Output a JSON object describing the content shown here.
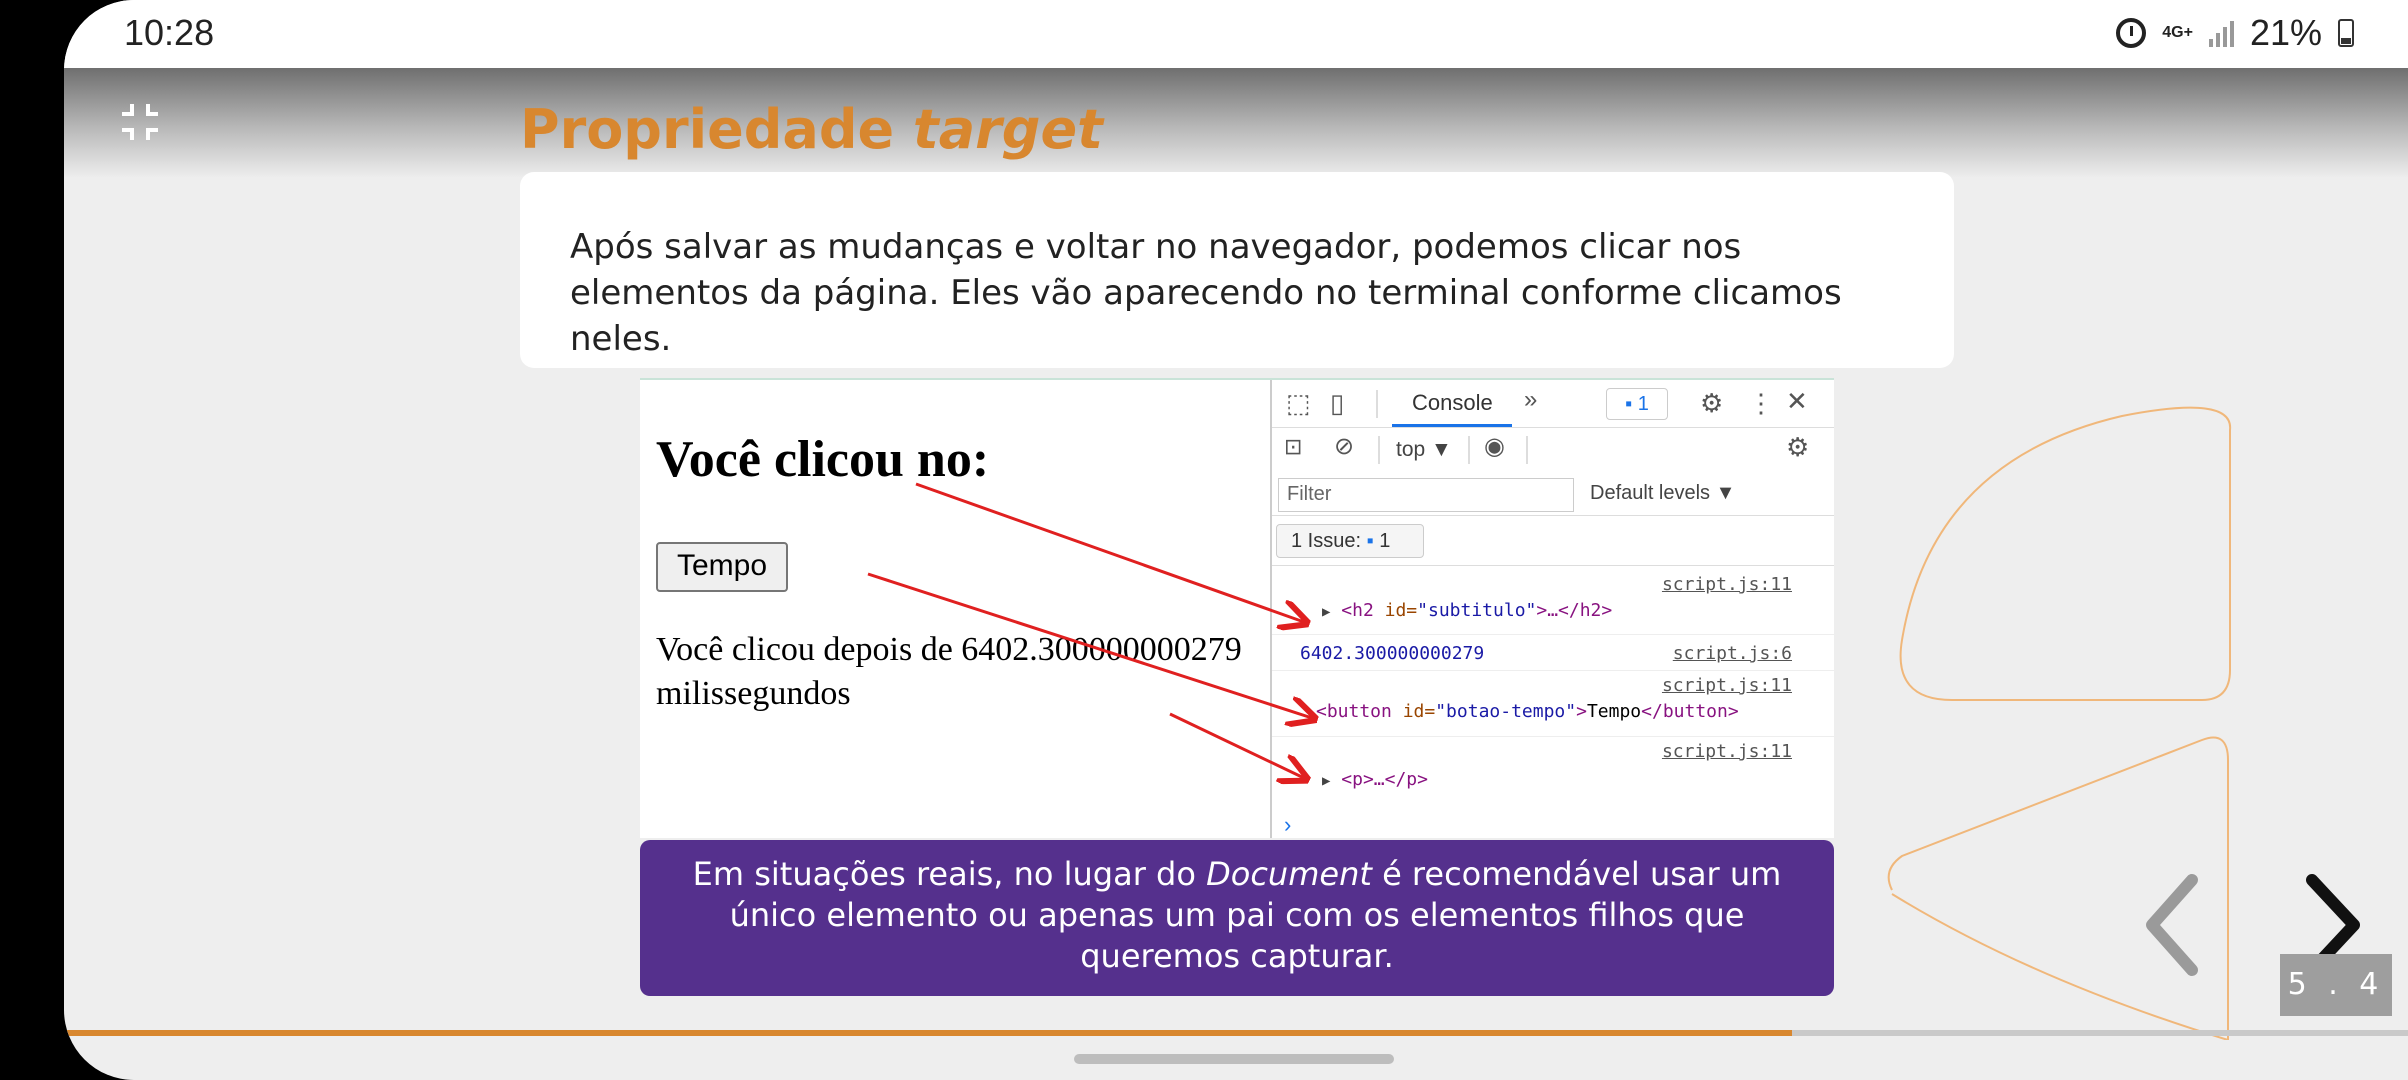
{
  "status_bar": {
    "time": "10:28",
    "network": "4G+",
    "battery": "21%"
  },
  "slide": {
    "title_plain": "Propriedade ",
    "title_italic": "target",
    "intro_text": "Após salvar as mudanças e voltar no navegador, podemos clicar nos elementos da página. Eles vão aparecendo no terminal conforme clicamos neles.",
    "note_part1": "Em situações reais, no lugar do ",
    "note_italic": "Document",
    "note_part2": " é recomendável usar um único elemento ou apenas um pai com os elementos filhos que queremos capturar.",
    "slide_number": "5 . 4",
    "progress": 0.737
  },
  "screenshot": {
    "page": {
      "heading": "Você clicou no:",
      "button_label": "Tempo",
      "paragraph": "Você clicou depois de 6402.300000000279 milissegundos"
    },
    "devtools": {
      "tab_console": "Console",
      "tab_more": "»",
      "badge_count": "1",
      "context": "top ▼",
      "filter_placeholder": "Filter",
      "levels": "Default levels ▼",
      "issues_label": "1 Issue:",
      "issues_count": "1",
      "logs": [
        {
          "source": "script.js:11",
          "line": "<h2 id=\"subtitulo\">…</h2>"
        },
        {
          "source": "script.js:6",
          "line": "6402.300000000279"
        },
        {
          "source": "script.js:11",
          "line": "<button id=\"botao-tempo\">Tempo</button>"
        },
        {
          "source": "script.js:11",
          "line": "<p>…</p>"
        }
      ],
      "log_parts": {
        "h2_open": "<h2",
        "h2_attr": " id=",
        "h2_val": "\"subtitulo\"",
        "h2_rest": ">…</h2>",
        "btn_open": "<button",
        "btn_attr": " id=",
        "btn_val": "\"botao-tempo\"",
        "btn_close_open": ">",
        "btn_text": "Tempo",
        "btn_close": "</button>",
        "p_tag": "<p>…</p>",
        "prompt": "›"
      }
    }
  },
  "colors": {
    "accent_orange": "#d8872f",
    "note_purple": "#55308d",
    "arrow_red": "#e02020"
  }
}
